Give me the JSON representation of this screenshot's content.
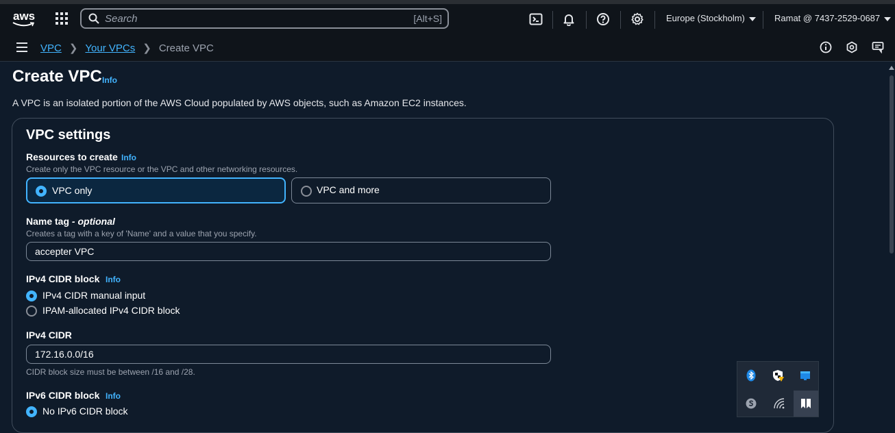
{
  "topnav": {
    "logo_text": "aws",
    "search_placeholder": "Search",
    "search_shortcut": "[Alt+S]",
    "region": "Europe (Stockholm)",
    "account": "Ramat @ 7437-2529-0687"
  },
  "breadcrumb": {
    "items": [
      "VPC",
      "Your VPCs"
    ],
    "current": "Create VPC"
  },
  "page": {
    "title": "Create VPC",
    "title_info": "Info",
    "description": "A VPC is an isolated portion of the AWS Cloud populated by AWS objects, such as Amazon EC2 instances."
  },
  "settings": {
    "title": "VPC settings",
    "resources": {
      "label": "Resources to create",
      "info": "Info",
      "hint": "Create only the VPC resource or the VPC and other networking resources.",
      "options": [
        "VPC only",
        "VPC and more"
      ],
      "selected": "VPC only"
    },
    "name_tag": {
      "label": "Name tag",
      "label_suffix": " - optional",
      "hint": "Creates a tag with a key of 'Name' and a value that you specify.",
      "value": "accepter VPC"
    },
    "ipv4_block": {
      "label": "IPv4 CIDR block",
      "info": "Info",
      "options": [
        "IPv4 CIDR manual input",
        "IPAM-allocated IPv4 CIDR block"
      ],
      "selected": "IPv4 CIDR manual input"
    },
    "ipv4_cidr": {
      "label": "IPv4 CIDR",
      "value": "172.16.0.0/16",
      "hint": "CIDR block size must be between /16 and /28."
    },
    "ipv6_block": {
      "label": "IPv6 CIDR block",
      "info": "Info",
      "options": [
        "No IPv6 CIDR block"
      ],
      "selected": "No IPv6 CIDR block"
    }
  },
  "colors": {
    "accent": "#42b4ff",
    "background": "#0f1b2a",
    "nav": "#0f141a"
  }
}
